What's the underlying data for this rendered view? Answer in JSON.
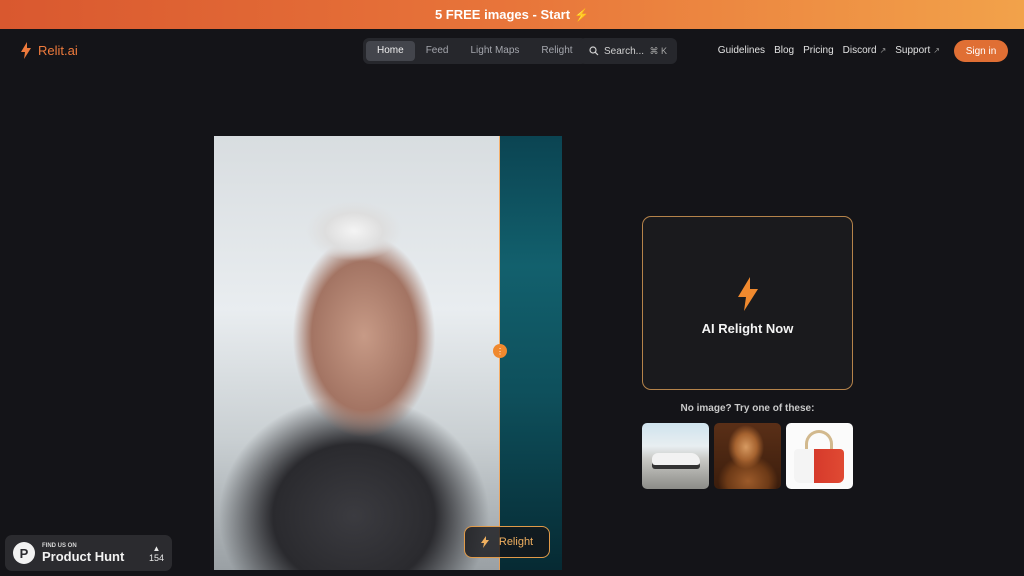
{
  "promo": {
    "text": "5 FREE images - Start"
  },
  "logo": {
    "name": "Relit.ai"
  },
  "nav": {
    "tabs": [
      {
        "label": "Home",
        "active": true
      },
      {
        "label": "Feed"
      },
      {
        "label": "Light Maps"
      },
      {
        "label": "Relight"
      }
    ],
    "search": {
      "placeholder": "Search...",
      "shortcut": "K"
    },
    "links": [
      {
        "label": "Guidelines"
      },
      {
        "label": "Blog"
      },
      {
        "label": "Pricing"
      },
      {
        "label": "Discord",
        "external": true
      },
      {
        "label": "Support",
        "external": true
      }
    ],
    "signin_label": "Sign in"
  },
  "preview": {
    "button_label": "Relight"
  },
  "cta": {
    "label": "AI Relight Now"
  },
  "samples": {
    "title": "No image? Try one of these:",
    "items": [
      "car",
      "statue",
      "handbag"
    ]
  },
  "product_hunt": {
    "small": "FIND US ON",
    "big": "Product Hunt",
    "votes": "154"
  },
  "colors": {
    "accent": "#e06f34",
    "bg": "#141418"
  }
}
